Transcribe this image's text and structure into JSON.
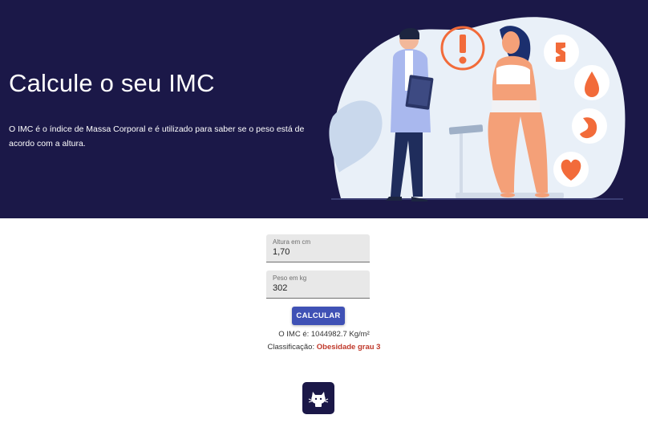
{
  "hero": {
    "title": "Calcule o seu IMC",
    "description": "O IMC é o índice de Massa Corporal e é utilizado para saber se o peso está de acordo com a altura."
  },
  "form": {
    "height": {
      "label": "Altura em cm",
      "value": "1,70"
    },
    "weight": {
      "label": "Peso em kg",
      "value": "302"
    },
    "submit_label": "CALCULAR"
  },
  "result": {
    "imc_text": "O IMC é: 1044982.7 Kg/m²",
    "class_label": "Classificação:",
    "class_value": "Obesidade grau 3"
  },
  "colors": {
    "hero_bg": "#1b1848",
    "button": "#3f51b5",
    "danger": "#c0392b",
    "accent": "#f26b3a"
  },
  "footer": {
    "icon": "github-octocat-icon"
  }
}
